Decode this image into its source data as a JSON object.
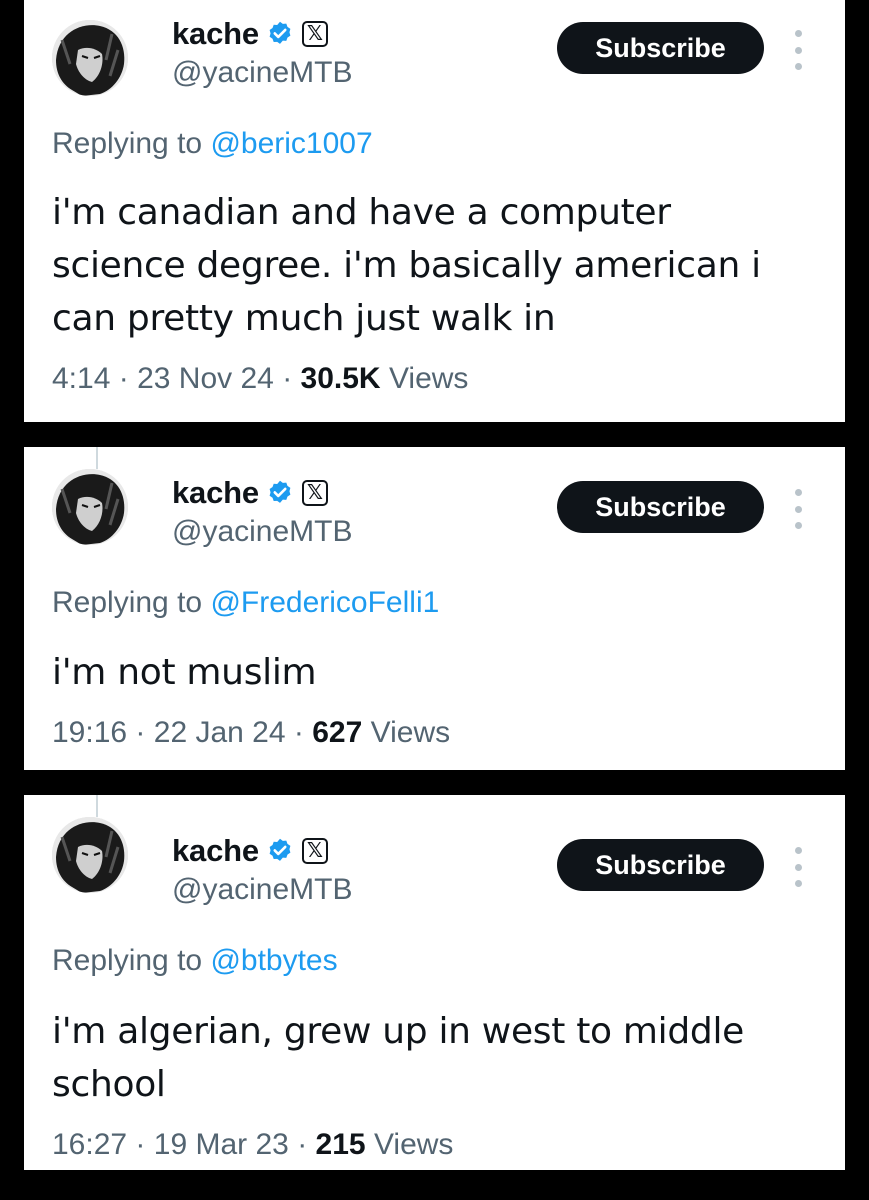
{
  "tweets": [
    {
      "display_name": "kache",
      "handle": "@yacineMTB",
      "subscribe_label": "Subscribe",
      "replying_prefix": "Replying to",
      "replying_to": "@beric1007",
      "text": "i'm canadian and have a computer science degree. i'm basically american i can pretty much just walk in",
      "time": "4:14",
      "date": "23 Nov 24",
      "views_count": "30.5K",
      "views_label": "Views",
      "separator": "·"
    },
    {
      "display_name": "kache",
      "handle": "@yacineMTB",
      "subscribe_label": "Subscribe",
      "replying_prefix": "Replying to",
      "replying_to": "@FredericoFelli1",
      "text": "i'm not muslim",
      "time": "19:16",
      "date": "22 Jan 24",
      "views_count": "627",
      "views_label": "Views",
      "separator": "·"
    },
    {
      "display_name": "kache",
      "handle": "@yacineMTB",
      "subscribe_label": "Subscribe",
      "replying_prefix": "Replying to",
      "replying_to": "@btbytes",
      "text": "i'm algerian, grew up in west to middle school",
      "time": "16:27",
      "date": "19 Mar 23",
      "views_count": "215",
      "views_label": "Views",
      "separator": "·"
    }
  ],
  "icons": {
    "verified": "verified-badge-icon",
    "affiliate": "x-logo-icon",
    "more": "more-vertical-icon"
  },
  "colors": {
    "background": "#000000",
    "card": "#ffffff",
    "text": "#0f1419",
    "secondary": "#536471",
    "link": "#1d9bf0",
    "button": "#0f1419"
  }
}
